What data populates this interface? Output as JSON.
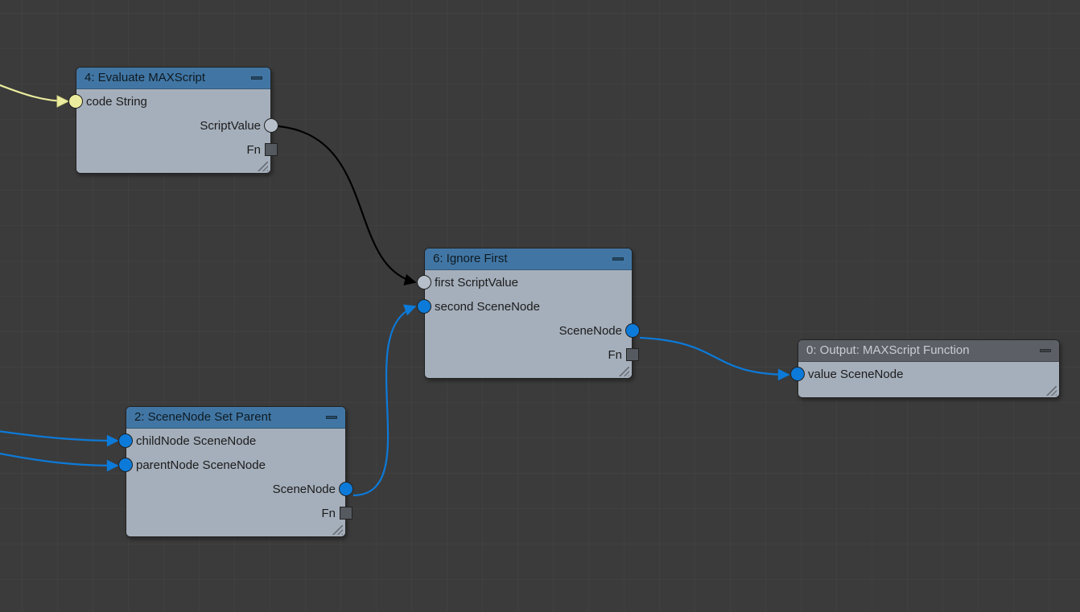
{
  "nodes": {
    "n4": {
      "title": "4: Evaluate MAXScript",
      "inputs": [
        "code String"
      ],
      "outputs": [
        "ScriptValue",
        "Fn"
      ]
    },
    "n6": {
      "title": "6: Ignore First",
      "inputs": [
        "first ScriptValue",
        "second SceneNode"
      ],
      "outputs": [
        "SceneNode",
        "Fn"
      ]
    },
    "n2": {
      "title": "2: SceneNode Set Parent",
      "inputs": [
        "childNode SceneNode",
        "parentNode SceneNode"
      ],
      "outputs": [
        "SceneNode",
        "Fn"
      ]
    },
    "n0": {
      "title": "0: Output: MAXScript Function",
      "inputs": [
        "value SceneNode"
      ]
    }
  },
  "edges": [
    {
      "from": "offscreen-left-top",
      "to": "n4.code",
      "color": "yellow"
    },
    {
      "from": "n4.ScriptValue",
      "to": "n6.first",
      "color": "black"
    },
    {
      "from": "offscreen-left-a",
      "to": "n2.childNode",
      "color": "blue"
    },
    {
      "from": "offscreen-left-b",
      "to": "n2.parentNode",
      "color": "blue"
    },
    {
      "from": "n2.SceneNode",
      "to": "n6.second",
      "color": "blue"
    },
    {
      "from": "n6.SceneNode",
      "to": "n0.value",
      "color": "blue"
    }
  ],
  "colors": {
    "accentBlue": "#0c7ad9",
    "accentYellow": "#ecec9f",
    "headerBlue": "#4176a4",
    "nodeBody": "#a5afbb",
    "canvas": "#3b3b3b"
  }
}
